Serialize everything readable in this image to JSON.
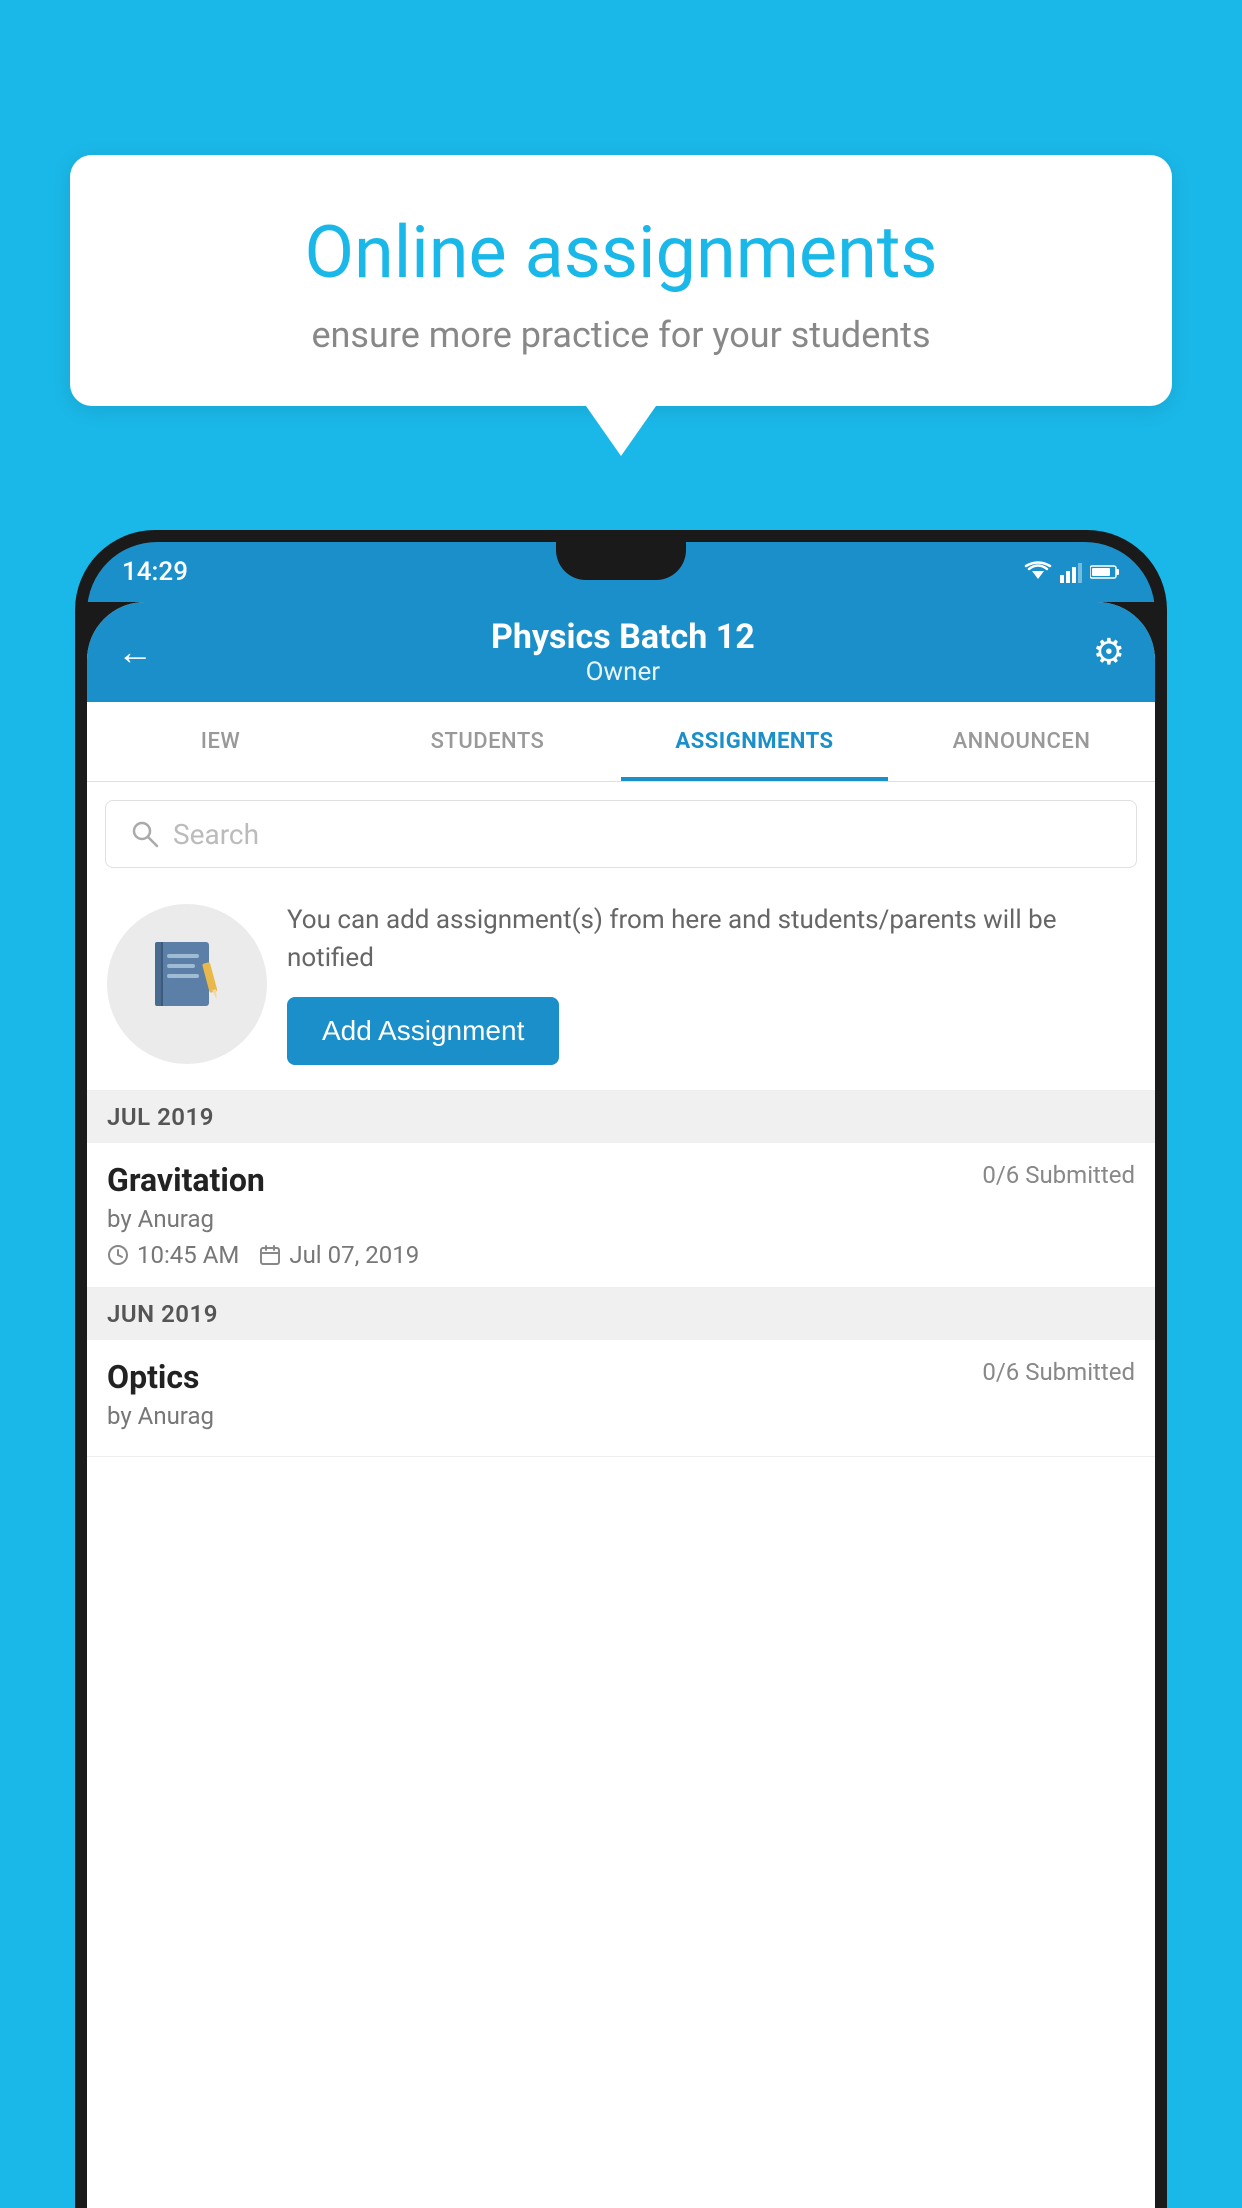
{
  "background_color": "#1ab8e8",
  "speech_bubble": {
    "title": "Online assignments",
    "subtitle": "ensure more practice for your students"
  },
  "status_bar": {
    "time": "14:29"
  },
  "app_header": {
    "title": "Physics Batch 12",
    "subtitle": "Owner",
    "back_label": "←",
    "settings_label": "⚙"
  },
  "tabs": [
    {
      "label": "IEW",
      "active": false
    },
    {
      "label": "STUDENTS",
      "active": false
    },
    {
      "label": "ASSIGNMENTS",
      "active": true
    },
    {
      "label": "ANNOUNCEN",
      "active": false
    }
  ],
  "search": {
    "placeholder": "Search"
  },
  "promo": {
    "text": "You can add assignment(s) from here and students/parents will be notified",
    "add_button_label": "Add Assignment",
    "icon": "📓"
  },
  "sections": [
    {
      "header": "JUL 2019",
      "assignments": [
        {
          "name": "Gravitation",
          "submitted": "0/6 Submitted",
          "author": "by Anurag",
          "time": "10:45 AM",
          "date": "Jul 07, 2019"
        }
      ]
    },
    {
      "header": "JUN 2019",
      "assignments": [
        {
          "name": "Optics",
          "submitted": "0/6 Submitted",
          "author": "by Anurag",
          "time": "",
          "date": ""
        }
      ]
    }
  ]
}
